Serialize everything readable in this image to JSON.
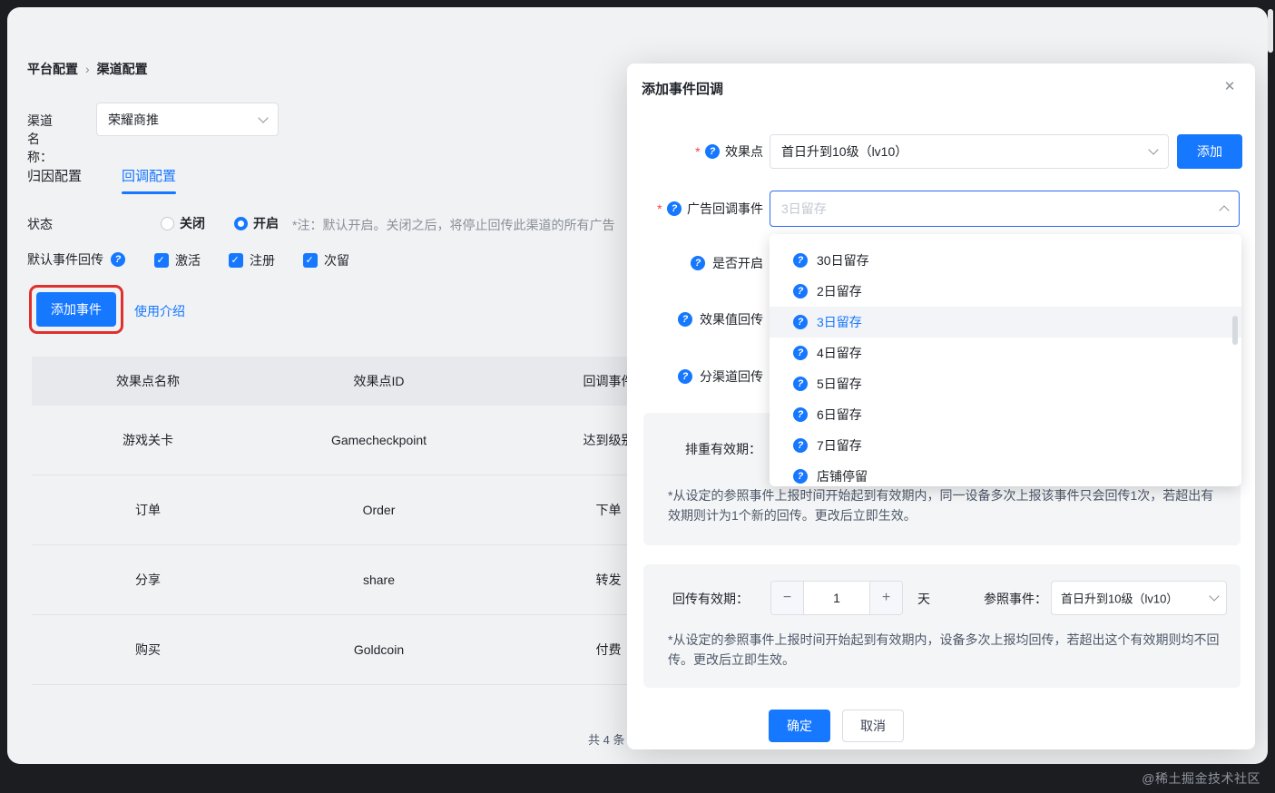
{
  "watermark": "@稀土掘金技术社区",
  "breadcrumb": {
    "items": [
      "平台配置",
      "渠道配置"
    ],
    "separator": "›"
  },
  "channel_name": {
    "label": "渠道名称：",
    "value": "荣耀商推"
  },
  "tabs": {
    "attribution": "归因配置",
    "callback": "回调配置"
  },
  "status": {
    "label": "状态",
    "off": "关闭",
    "on": "开启",
    "note": "*注：默认开启。关闭之后，将停止回传此渠道的所有广告"
  },
  "default_events": {
    "label": "默认事件回传",
    "items": [
      {
        "label": "激活"
      },
      {
        "label": "注册"
      },
      {
        "label": "次留"
      }
    ]
  },
  "toolbar": {
    "add_event": "添加事件",
    "usage_intro": "使用介绍"
  },
  "table": {
    "headers": [
      "效果点名称",
      "效果点ID",
      "回调事件"
    ],
    "rows": [
      {
        "name": "游戏关卡",
        "id": "Gamecheckpoint",
        "event": "达到级别"
      },
      {
        "name": "订单",
        "id": "Order",
        "event": "下单"
      },
      {
        "name": "分享",
        "id": "share",
        "event": "转发"
      },
      {
        "name": "购买",
        "id": "Goldcoin",
        "event": "付费"
      }
    ],
    "total": "共 4 条"
  },
  "modal": {
    "title": "添加事件回调",
    "effect_point": {
      "label": "效果点",
      "value": "首日升到10级（lv10）",
      "add": "添加"
    },
    "ad_callback": {
      "label": "广告回调事件",
      "placeholder": "3日留存"
    },
    "side_labels": {
      "enable": "是否开启",
      "value_callback": "效果值回传",
      "channel_callback": "分渠道回传"
    },
    "dropdown": {
      "items": [
        "30日留存",
        "2日留存",
        "3日留存",
        "4日留存",
        "5日留存",
        "6日留存",
        "7日留存",
        "店铺停留"
      ],
      "selected": "3日留存"
    },
    "dedup": {
      "label": "排重有效期：",
      "note": "*从设定的参照事件上报时间开始起到有效期内，同一设备多次上报该事件只会回传1次，若超出有效期则计为1个新的回传。更改后立即生效。"
    },
    "validity": {
      "label": "回传有效期：",
      "value": "1",
      "unit": "天",
      "ref_label": "参照事件：",
      "ref_value": "首日升到10级（lv10）",
      "note": "*从设定的参照事件上报时间开始起到有效期内，设备多次上报均回传，若超出这个有效期则均不回传。更改后立即生效。"
    },
    "footer": {
      "ok": "确定",
      "cancel": "取消"
    },
    "colors": {
      "primary": "#1677ff",
      "annotation_red": "#e0302e",
      "required_red": "#f53f3f"
    }
  }
}
